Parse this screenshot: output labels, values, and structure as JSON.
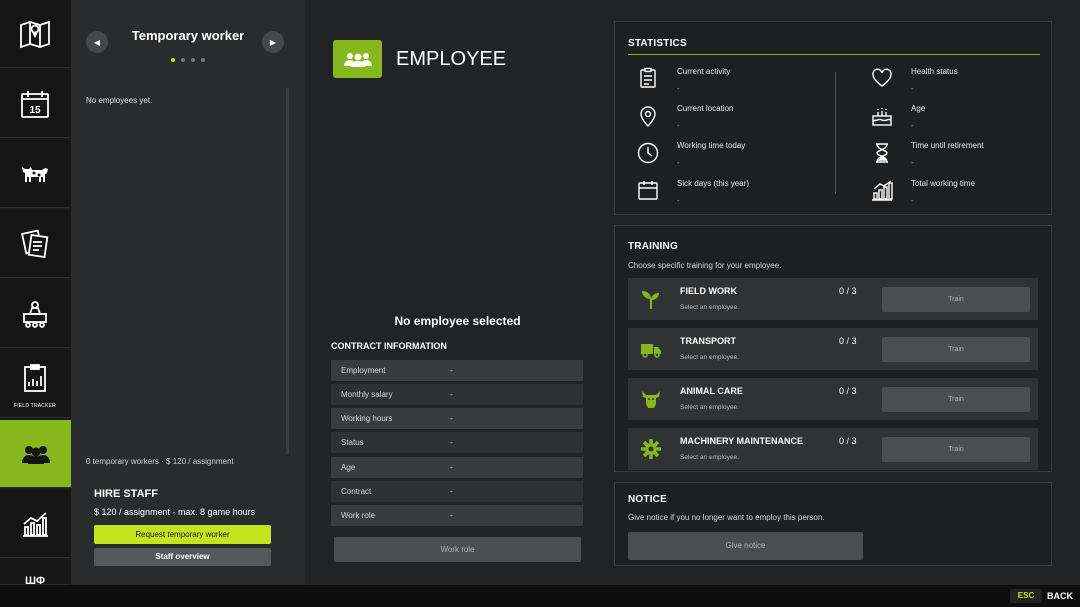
{
  "nav": {
    "items": [
      {
        "name": "map",
        "icon": "map-icon"
      },
      {
        "name": "calendar",
        "icon": "calendar-icon",
        "text": "15"
      },
      {
        "name": "animals",
        "icon": "cow-icon"
      },
      {
        "name": "contracts",
        "icon": "documents-icon"
      },
      {
        "name": "production",
        "icon": "factory-icon"
      },
      {
        "name": "field-tracker",
        "icon": "field-tracker-icon",
        "label": "FIELD TRACKER"
      },
      {
        "name": "workers",
        "icon": "workers-icon",
        "active": true
      },
      {
        "name": "statistics",
        "icon": "chart-icon"
      },
      {
        "name": "more",
        "icon": "more-icon",
        "label": "ШΦ"
      }
    ]
  },
  "left": {
    "title": "Temporary worker",
    "page_dots": 4,
    "active_dot": 0,
    "empty_text": "No employees yet.",
    "summary": "0 temporary workers · $ 120 / assignment",
    "hire_title": "HIRE STAFF",
    "hire_info": "$ 120 / assignment · max. 8 game hours",
    "request_button": "Request temporary worker",
    "overview_button": "Staff overview"
  },
  "employee": {
    "header": "EMPLOYEE",
    "no_selection": "No employee selected",
    "contract_title": "CONTRACT INFORMATION",
    "contract_rows": [
      {
        "label": "Employment",
        "value": "-"
      },
      {
        "label": "Monthly salary",
        "value": "-"
      },
      {
        "label": "Working hours",
        "value": "-"
      },
      {
        "label": "Status",
        "value": "-"
      },
      {
        "label": "Age",
        "value": "-"
      },
      {
        "label": "Contract",
        "value": "-"
      },
      {
        "label": "Work role",
        "value": "-"
      }
    ],
    "work_role_button": "Work role"
  },
  "statistics": {
    "title": "STATISTICS",
    "left": [
      {
        "label": "Current activity",
        "value": "-",
        "icon": "clipboard-icon"
      },
      {
        "label": "Current location",
        "value": "-",
        "icon": "location-pin-icon"
      },
      {
        "label": "Working time today",
        "value": "-",
        "icon": "clock-icon"
      },
      {
        "label": "Sick days (this year)",
        "value": "-",
        "icon": "calendar-icon"
      }
    ],
    "right": [
      {
        "label": "Health status",
        "value": "-",
        "icon": "heart-icon"
      },
      {
        "label": "Age",
        "value": "-",
        "icon": "cake-icon"
      },
      {
        "label": "Time until retirement",
        "value": "-",
        "icon": "hourglass-icon"
      },
      {
        "label": "Total working time",
        "value": "-",
        "icon": "bar-chart-icon"
      }
    ]
  },
  "training": {
    "title": "TRAINING",
    "subtitle": "Choose specific training for your employee.",
    "items": [
      {
        "name": "FIELD WORK",
        "sub": "Select an employee.",
        "count": "0 / 3",
        "button": "Train",
        "icon": "sprout-icon"
      },
      {
        "name": "TRANSPORT",
        "sub": "Select an employee.",
        "count": "0 / 3",
        "button": "Train",
        "icon": "truck-icon"
      },
      {
        "name": "ANIMAL CARE",
        "sub": "Select an employee.",
        "count": "0 / 3",
        "button": "Train",
        "icon": "cow-head-icon"
      },
      {
        "name": "MACHINERY MAINTENANCE",
        "sub": "Select an employee.",
        "count": "0 / 3",
        "button": "Train",
        "icon": "gear-icon"
      }
    ]
  },
  "notice": {
    "title": "NOTICE",
    "subtitle": "Give notice if you no longer want to employ this person.",
    "button": "Give notice"
  },
  "footer": {
    "esc_key": "ESC",
    "back_label": "BACK"
  },
  "colors": {
    "accent": "#86b81e",
    "accent_bright": "#c4e41f"
  }
}
